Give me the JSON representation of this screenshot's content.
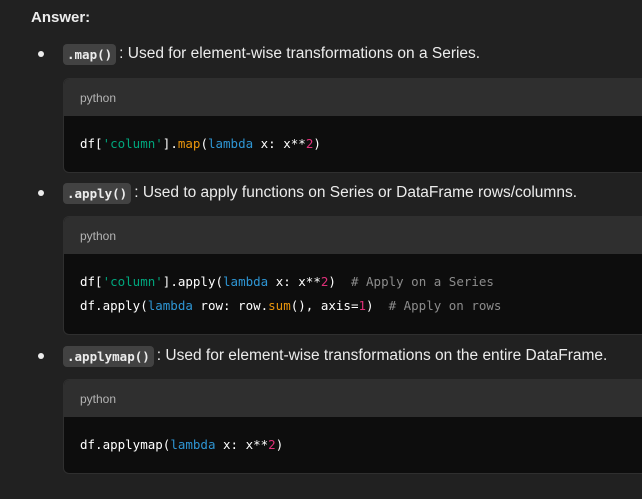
{
  "answer_heading": "Answer:",
  "items": [
    {
      "method": ".map()",
      "description": ": Used for element-wise transformations on a Series.",
      "code_lang": "python",
      "code_lines": [
        [
          {
            "t": "df[",
            "c": "plain"
          },
          {
            "t": "'column'",
            "c": "str"
          },
          {
            "t": "].",
            "c": "plain"
          },
          {
            "t": "map",
            "c": "call"
          },
          {
            "t": "(",
            "c": "plain"
          },
          {
            "t": "lambda",
            "c": "kw"
          },
          {
            "t": " x: x**",
            "c": "plain"
          },
          {
            "t": "2",
            "c": "num"
          },
          {
            "t": ")",
            "c": "plain"
          }
        ]
      ]
    },
    {
      "method": ".apply()",
      "description": ": Used to apply functions on Series or DataFrame rows/columns.",
      "code_lang": "python",
      "code_lines": [
        [
          {
            "t": "df[",
            "c": "plain"
          },
          {
            "t": "'column'",
            "c": "str"
          },
          {
            "t": "].apply(",
            "c": "plain"
          },
          {
            "t": "lambda",
            "c": "kw"
          },
          {
            "t": " x: x**",
            "c": "plain"
          },
          {
            "t": "2",
            "c": "num"
          },
          {
            "t": ")  ",
            "c": "plain"
          },
          {
            "t": "# Apply on a Series",
            "c": "com"
          }
        ],
        [
          {
            "t": "df.apply(",
            "c": "plain"
          },
          {
            "t": "lambda",
            "c": "kw"
          },
          {
            "t": " row: row.",
            "c": "plain"
          },
          {
            "t": "sum",
            "c": "call"
          },
          {
            "t": "(), axis=",
            "c": "plain"
          },
          {
            "t": "1",
            "c": "num"
          },
          {
            "t": ")  ",
            "c": "plain"
          },
          {
            "t": "# Apply on rows",
            "c": "com"
          }
        ]
      ]
    },
    {
      "method": ".applymap()",
      "description": ": Used for element-wise transformations on the entire DataFrame.",
      "code_lang": "python",
      "code_lines": [
        [
          {
            "t": "df.applymap(",
            "c": "plain"
          },
          {
            "t": "lambda",
            "c": "kw"
          },
          {
            "t": " x: x**",
            "c": "plain"
          },
          {
            "t": "2",
            "c": "num"
          },
          {
            "t": ")",
            "c": "plain"
          }
        ]
      ]
    }
  ],
  "colors": {
    "background": "#212121",
    "code_background": "#0d0d0d",
    "code_header": "#2f2f2f",
    "string": "#00a67d",
    "keyword": "#2e95d3",
    "number": "#df3079",
    "comment": "#8c8c8c",
    "call": "#e9950c"
  }
}
